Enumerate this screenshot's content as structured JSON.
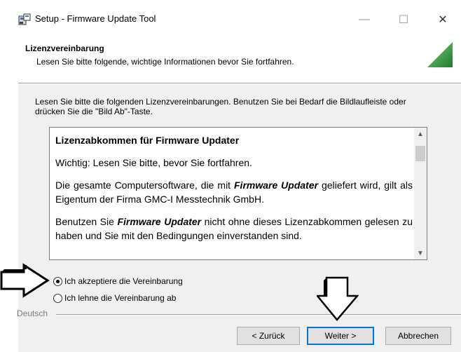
{
  "window": {
    "title": "Setup - Firmware Update Tool",
    "minimize_glyph": "—",
    "maximize_glyph": "☐",
    "close_glyph": "✕"
  },
  "header": {
    "title": "Lizenzvereinbarung",
    "subtitle": "Lesen Sie bitte folgende, wichtige Informationen bevor Sie fortfahren."
  },
  "instructions": "Lesen Sie bitte die folgenden Lizenzvereinbarungen. Benutzen Sie bei Bedarf die Bildlaufleiste oder drücken Sie die \"Bild Ab\"-Taste.",
  "license": {
    "heading": "Lizenzabkommen für Firmware Updater",
    "p1": "Wichtig: Lesen Sie bitte, bevor Sie fortfahren.",
    "p2_a": "Die gesamte Computersoftware, die mit ",
    "p2_em": "Firmware Updater",
    "p2_b": " geliefert wird, gilt als Eigentum der Firma GMC-I Messtechnik GmbH.",
    "p3_a": "Benutzen Sie ",
    "p3_em": "Firmware Updater",
    "p3_b": " nicht ohne dieses Lizenzabkommen gelesen zu haben und Sie mit den Bedingungen einverstanden sind."
  },
  "options": {
    "accept_label": "Ich akzeptiere die Vereinbarung",
    "decline_label": "Ich lehne die Vereinbarung ab",
    "selected": "accept"
  },
  "language_label": "Deutsch",
  "buttons": {
    "back": "< Zurück",
    "next": "Weiter >",
    "cancel": "Abbrechen"
  },
  "icons": {
    "app": "setup-installer-icon",
    "header_logo": "green-triangle-logo",
    "annotation_left": "hollow-arrow-right",
    "annotation_down": "hollow-arrow-down"
  },
  "colors": {
    "accent": "#0078d7",
    "logo_green": "#2e8b3a"
  }
}
